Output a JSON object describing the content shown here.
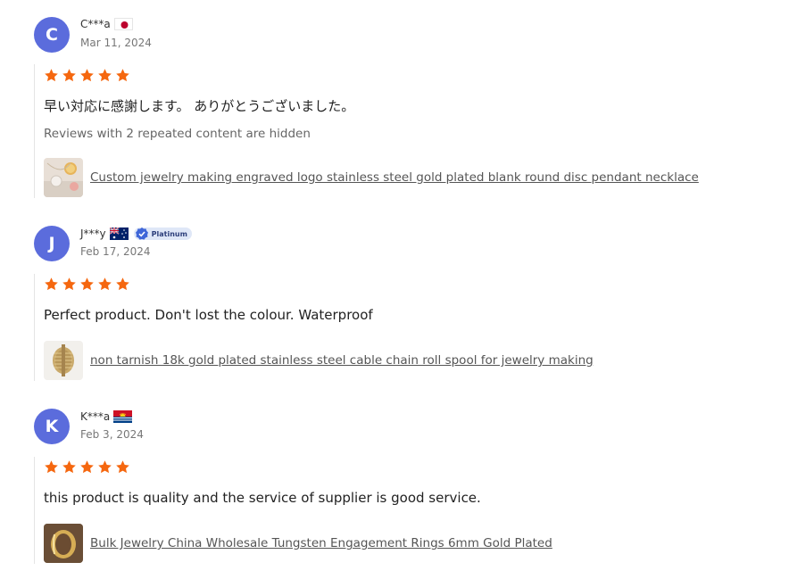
{
  "colors": {
    "avatar": "#5b6cdc",
    "star": "#f5670f",
    "link": "#555555"
  },
  "reviews": [
    {
      "initial": "C",
      "name": "C***a",
      "country_flag": "japan-flag-icon",
      "badge": null,
      "date": "Mar 11, 2024",
      "rating": 5,
      "text": "早い対応に感謝します。 ありがとうございました。",
      "hidden_note": "Reviews with 2 repeated content are hidden",
      "product_title": "Custom jewelry making engraved logo stainless steel gold plated blank round disc pendant necklace"
    },
    {
      "initial": "J",
      "name": "J***y",
      "country_flag": "australia-flag-icon",
      "badge": "Platinum",
      "date": "Feb 17, 2024",
      "rating": 5,
      "text": "Perfect product. Don't lost the colour. Waterproof",
      "product_title": "non tarnish 18k gold plated stainless steel cable chain roll spool for jewelry making"
    },
    {
      "initial": "K",
      "name": "K***a",
      "country_flag": "kiribati-flag-icon",
      "badge": null,
      "date": "Feb 3, 2024",
      "rating": 5,
      "text": "this product is quality and the service of supplier is good service.",
      "product_title": "Bulk Jewelry China Wholesale Tungsten Engagement Rings 6mm Gold Plated"
    }
  ]
}
